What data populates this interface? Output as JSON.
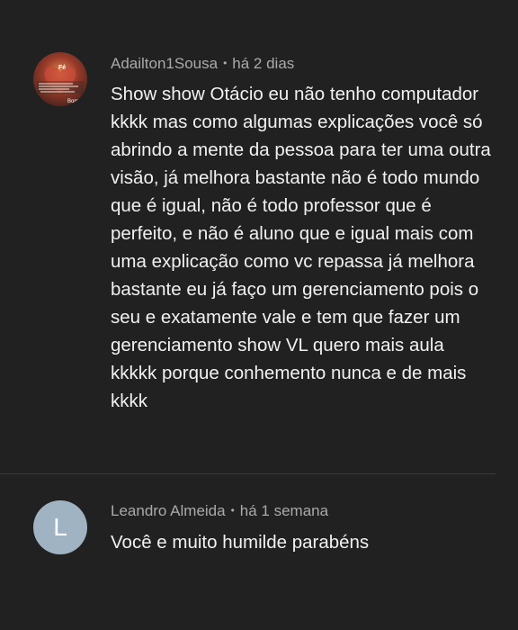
{
  "comments": [
    {
      "author": "Adailton1Sousa",
      "separator": "•",
      "time": "há 2 dias",
      "avatar_icon": "photo-avatar-icon",
      "avatar_badge": "Fé",
      "avatar_caption": "Bom",
      "text": "Show show Otácio eu não tenho computador kkkk mas como algumas explicações você só abrindo a mente da pessoa para ter uma outra visão, já melhora bastante não é todo mundo que é igual, não é todo professor que é perfeito, e não é aluno que e igual  mais com uma explicação como vc repassa já melhora bastante eu já faço um gerenciamento pois o seu e exatamente vale e tem que fazer um gerenciamento show VL quero mais aula kkkkk porque conhemento nunca e de mais kkkk"
    },
    {
      "author": "Leandro Almeida",
      "separator": "•",
      "time": "há 1 semana",
      "avatar_letter": "L",
      "avatar_color": "#9fb3c3",
      "text": "Você e muito humilde parabéns"
    }
  ],
  "colors": {
    "background": "#212121",
    "text_primary": "#f1f1f1",
    "text_secondary": "#aaaaaa",
    "divider": "#3a3a3a"
  }
}
